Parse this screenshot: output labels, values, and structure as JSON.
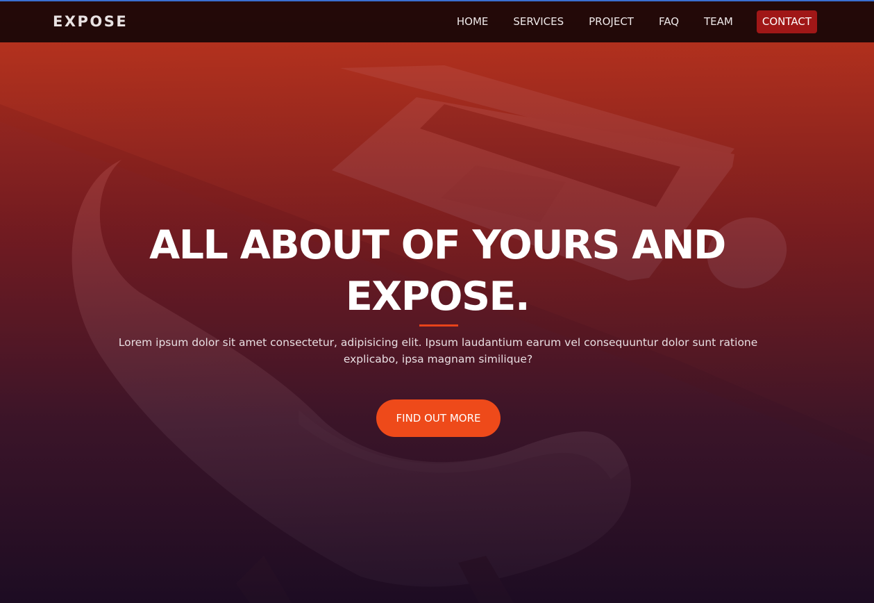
{
  "navbar": {
    "brand": "EXPOSE",
    "items": [
      {
        "label": "HOME"
      },
      {
        "label": "SERVICES"
      },
      {
        "label": "PROJECT"
      },
      {
        "label": "FAQ"
      },
      {
        "label": "TEAM"
      },
      {
        "label": "CONTACT"
      }
    ]
  },
  "hero": {
    "title_line1": "ALL ABOUT OF YOURS AND",
    "title_line2": "EXPOSE.",
    "text": "Lorem ipsum dolor sit amet consectetur, adipisicing elit. Ipsum laudantium earum vel consequuntur dolor sunt ratione explicabo, ipsa magnam similique?",
    "cta_label": "FIND OUT MORE"
  },
  "colors": {
    "accent": "#ee4a1a",
    "contact_bg": "#a01717",
    "overlay_top": "#b8301a",
    "overlay_bottom": "#1e0c22"
  }
}
